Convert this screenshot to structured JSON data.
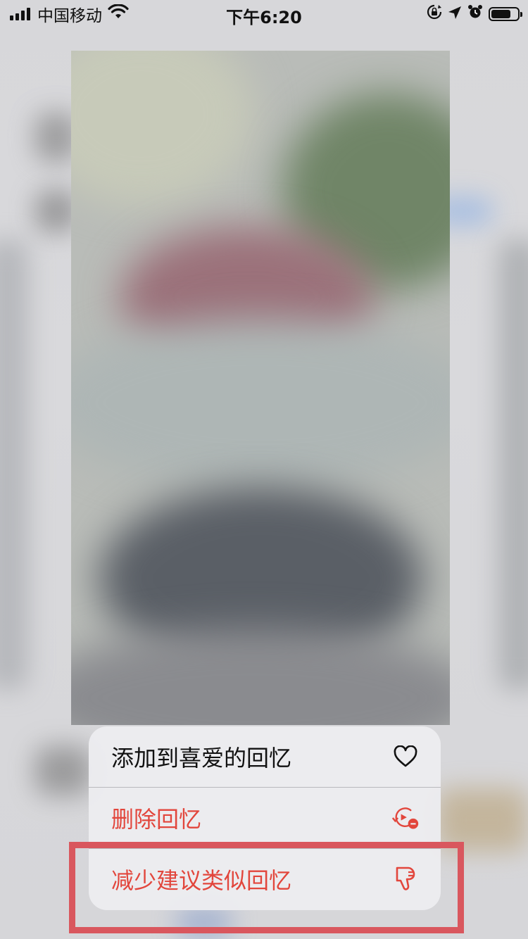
{
  "status_bar": {
    "carrier": "中国移动",
    "time": "下午6:20",
    "signal_bars": 4,
    "battery_level_percent": 75,
    "icons": [
      "signal-icon",
      "wifi-icon",
      "orientation-lock-icon",
      "location-icon",
      "alarm-icon",
      "battery-icon"
    ]
  },
  "menu": {
    "items": [
      {
        "label": "添加到喜爱的回忆",
        "icon": "heart-icon",
        "color": "#111111"
      },
      {
        "label": "删除回忆",
        "icon": "delete-memory-icon",
        "color": "#e2463c"
      },
      {
        "label": "减少建议类似回忆",
        "icon": "thumbs-down-icon",
        "color": "#e2463c"
      }
    ]
  },
  "colors": {
    "destructive": "#e2463c",
    "highlight_box": "#d9575e"
  }
}
